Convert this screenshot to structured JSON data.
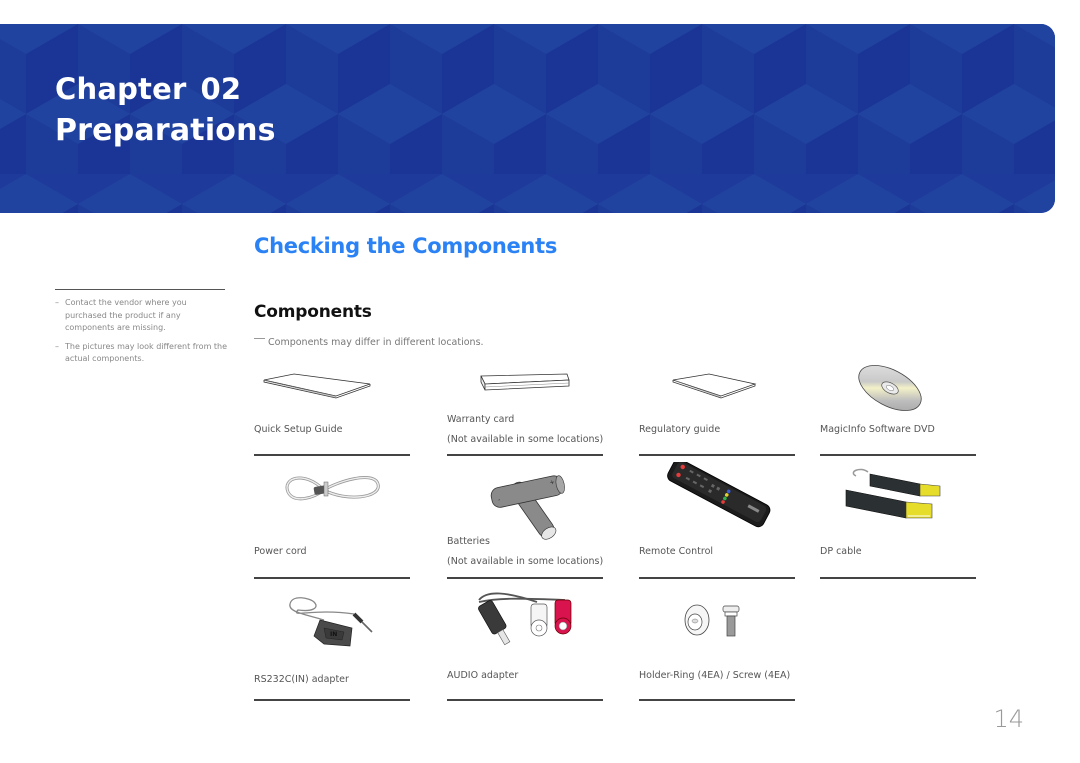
{
  "banner": {
    "chapter_label": "Chapter",
    "chapter_number": "02",
    "title": "Preparations",
    "background_color": "#1e3a9a"
  },
  "section": {
    "title": "Checking the Components",
    "title_color": "#2b82f4",
    "subtitle": "Components",
    "note": "Components may differ in different locations."
  },
  "sidebar": {
    "notes": [
      "Contact the vendor where you purchased the product if any components are missing.",
      "The pictures may look different from the actual components."
    ]
  },
  "components": [
    {
      "name": "Quick Setup Guide",
      "note": "",
      "icon": "booklet-icon"
    },
    {
      "name": "Warranty card",
      "note": "(Not available in some locations)",
      "icon": "card-icon"
    },
    {
      "name": "Regulatory guide",
      "note": "",
      "icon": "booklet-icon"
    },
    {
      "name": "MagicInfo Software DVD",
      "note": "",
      "icon": "dvd-icon"
    },
    {
      "name": "Power cord",
      "note": "",
      "icon": "power-cord-icon"
    },
    {
      "name": "Batteries",
      "note": "(Not available in some locations)",
      "icon": "batteries-icon"
    },
    {
      "name": "Remote Control",
      "note": "",
      "icon": "remote-control-icon"
    },
    {
      "name": "DP cable",
      "note": "",
      "icon": "dp-cable-icon"
    },
    {
      "name": "RS232C(IN) adapter",
      "note": "",
      "icon": "rs232c-adapter-icon"
    },
    {
      "name": "AUDIO adapter",
      "note": "",
      "icon": "audio-adapter-icon"
    },
    {
      "name": "Holder-Ring (4EA) / Screw (4EA)",
      "note": "",
      "icon": "holder-ring-screw-icon"
    }
  ],
  "page_number": "14"
}
